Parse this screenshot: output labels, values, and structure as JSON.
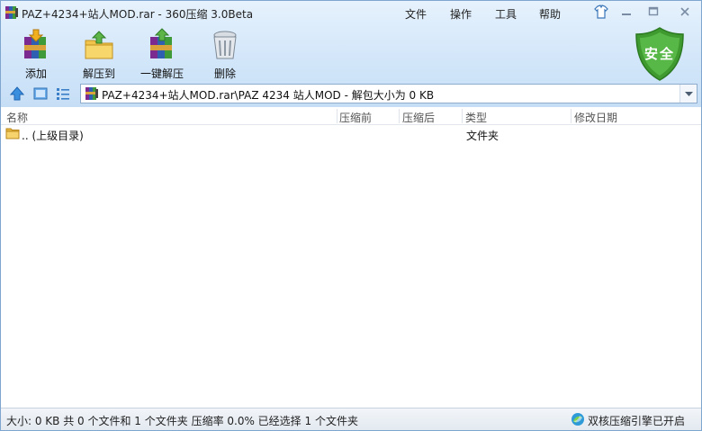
{
  "window": {
    "title": "PAZ+4234+站人MOD.rar - 360压缩 3.0Beta",
    "menu": [
      "文件",
      "操作",
      "工具",
      "帮助"
    ],
    "controls": {
      "skin": "shirt-icon",
      "minimize": "minimize-icon",
      "maximize": "maximize-icon",
      "close": "close-icon"
    }
  },
  "toolbar": {
    "buttons": [
      {
        "label": "添加",
        "icon": "add-archive-icon"
      },
      {
        "label": "解压到",
        "icon": "extract-to-icon"
      },
      {
        "label": "一键解压",
        "icon": "one-click-extract-icon"
      },
      {
        "label": "删除",
        "icon": "trash-icon"
      }
    ]
  },
  "security": {
    "label": "安全",
    "color": "#4aa63a"
  },
  "nav": {
    "icons": [
      "up-arrow-icon",
      "thumbnail-view-icon",
      "list-view-icon"
    ],
    "address": "PAZ+4234+站人MOD.rar\\PAZ 4234 站人MOD - 解包大小为 0 KB"
  },
  "list": {
    "columns": [
      "名称",
      "压缩前",
      "压缩后",
      "类型",
      "修改日期"
    ],
    "rows": [
      {
        "name": ".. (上级目录)",
        "type": "文件夹"
      }
    ]
  },
  "status": {
    "text": "大小: 0 KB 共 0 个文件和 1 个文件夹 压缩率 0.0% 已经选择 1 个文件夹",
    "engine": "双核压缩引擎已开启"
  }
}
